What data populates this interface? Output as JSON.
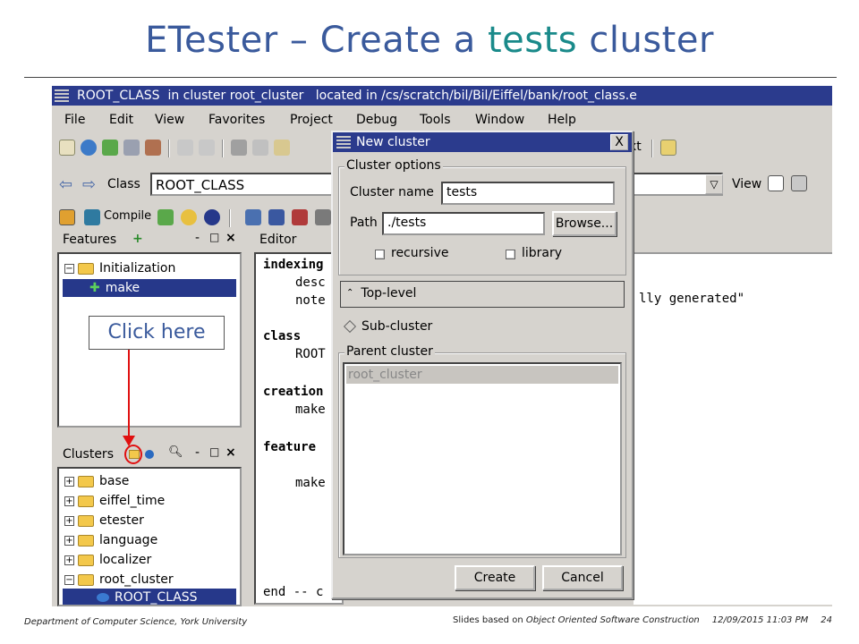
{
  "slide": {
    "title_part1": "ETester – Create a ",
    "title_accent": "tests",
    "title_part2": " cluster",
    "footer_left": "Department of Computer Science, York University",
    "footer_slides_prefix": "Slides based on ",
    "footer_book": "Object Oriented Software Construction",
    "footer_date": "12/09/2015 11:03 PM",
    "footer_page": "24"
  },
  "window": {
    "title": "ROOT_CLASS  in cluster root_cluster   located in /cs/scratch/bil/Bil/Eiffel/bank/root_class.e"
  },
  "menu": [
    "File",
    "Edit",
    "View",
    "Favorites",
    "Project",
    "Debug",
    "Tools",
    "Window",
    "Help"
  ],
  "toolbar": {
    "partial_label": "xt"
  },
  "classbar": {
    "label": "Class",
    "value": "ROOT_CLASS",
    "view_label": "View"
  },
  "compilebar": {
    "compile_label": "Compile"
  },
  "features_panel": {
    "title": "Features",
    "items": [
      {
        "label": "Initialization"
      },
      {
        "label": "make",
        "selected": true
      }
    ]
  },
  "clusters_panel": {
    "title": "Clusters",
    "items": [
      {
        "label": "base"
      },
      {
        "label": "eiffel_time"
      },
      {
        "label": "etester"
      },
      {
        "label": "language"
      },
      {
        "label": "localizer"
      },
      {
        "label": "root_cluster",
        "expanded": true
      },
      {
        "label": "ROOT_CLASS",
        "selected": true
      }
    ]
  },
  "editor": {
    "title": "Editor",
    "lines": [
      "indexing",
      "desc",
      "note",
      "class",
      "ROOT",
      "creation",
      "make",
      "feature",
      "make",
      "end -- c"
    ],
    "partial_string": "lly generated\""
  },
  "dialog": {
    "title": "New cluster",
    "close": "X",
    "cluster_options_legend": "Cluster options",
    "cluster_name_label": "Cluster name",
    "cluster_name_value": "tests",
    "path_label": "Path",
    "path_value": "./tests",
    "browse_button": "Browse...",
    "recursive_label": "recursive",
    "library_label": "library",
    "top_level_label": "Top-level",
    "sub_cluster_label": "Sub-cluster",
    "parent_cluster_legend": "Parent cluster",
    "parent_cluster_item": "root_cluster",
    "create_button": "Create",
    "cancel_button": "Cancel"
  },
  "annotation": {
    "callout": "Click here"
  },
  "colors": {
    "title_blue": "#3a5a9c",
    "accent_teal": "#1a8a8a",
    "titlebar": "#2b3b8d",
    "arrow_red": "#e01010"
  }
}
